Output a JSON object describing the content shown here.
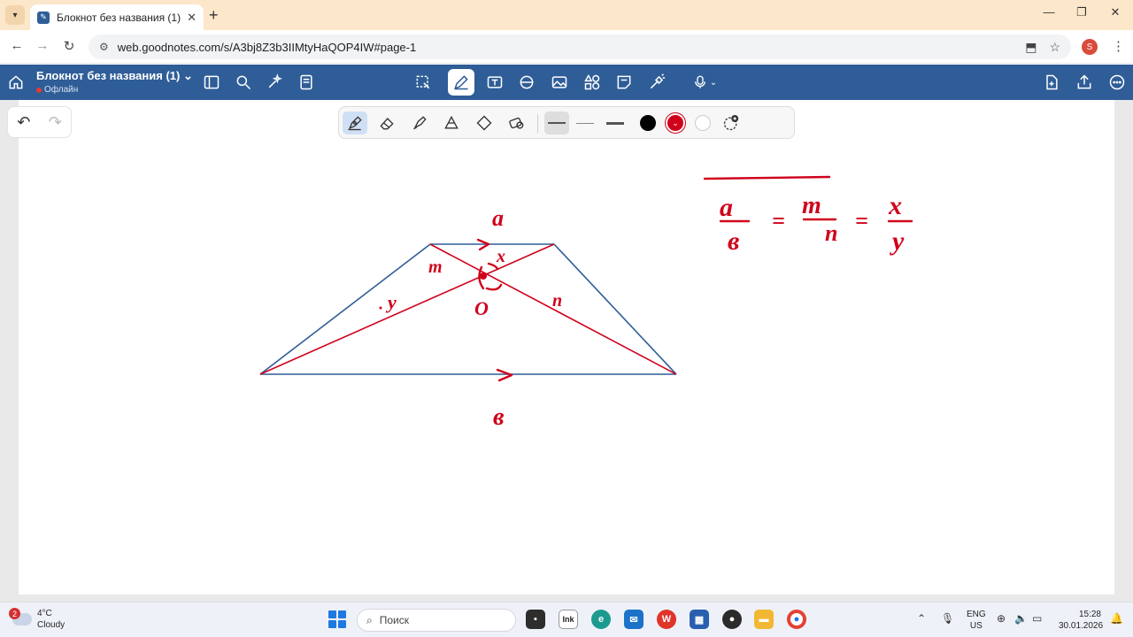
{
  "browser": {
    "tab_title": "Блокнот без названия (1)",
    "tab_close": "✕",
    "new_tab": "+",
    "url": "web.goodnotes.com/s/A3bj8Z3b3IIMtyHaQOP4IW#page-1",
    "profile_initial": "S",
    "window_minimize": "—",
    "window_restore": "❐",
    "window_close": "✕"
  },
  "app": {
    "doc_title": "Блокнот без названия (1)",
    "doc_status": "Офлайн",
    "accent_color": "#2f5d97"
  },
  "pen_toolbar": {
    "active_color": "#d0021b",
    "colors": [
      "#000000",
      "#d0021b",
      "#ffffff"
    ]
  },
  "drawing": {
    "label_top": "a",
    "label_bottom": "в",
    "label_m": "m",
    "label_x": "x",
    "label_y": "y",
    "label_n": "n",
    "label_o": "O",
    "eq_num1": "a",
    "eq_den1": "в",
    "eq_eq1": "=",
    "eq_num2": "m",
    "eq_den2": "n",
    "eq_eq2": "=",
    "eq_num3": "x",
    "eq_den3": "y",
    "trapezoid_color": "#2f5d97",
    "ink_color": "#d0021b"
  },
  "taskbar": {
    "weather_badge": "2",
    "temperature": "4°C",
    "weather": "Cloudy",
    "search_placeholder": "Поиск",
    "lang_top": "ENG",
    "lang_bottom": "US",
    "time": "15:28",
    "date": "30.01.2026"
  }
}
